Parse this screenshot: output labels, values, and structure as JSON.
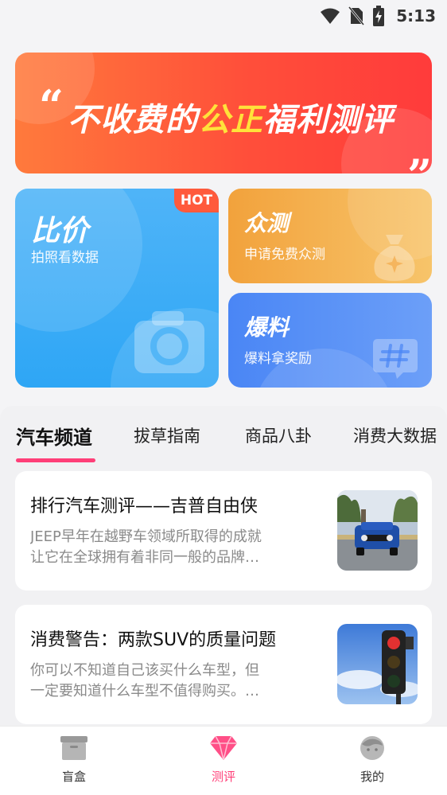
{
  "status_bar": {
    "time": "5:13"
  },
  "hero": {
    "title_prefix": "不收费的",
    "title_highlight": "公正",
    "title_suffix": "福利测评",
    "quote_open": "“",
    "quote_close": "„"
  },
  "cards": {
    "compare": {
      "title": "比价",
      "subtitle": "拍照看数据",
      "badge": "HOT",
      "icon": "camera-icon"
    },
    "crowd": {
      "title": "众测",
      "subtitle": "申请免费众测",
      "icon": "money-bag-icon"
    },
    "leak": {
      "title": "爆料",
      "subtitle": "爆料拿奖励",
      "icon": "hashtag-chat-icon"
    }
  },
  "tabs": [
    "汽车频道",
    "拔草指南",
    "商品八卦",
    "消费大数据"
  ],
  "active_tab": "汽车频道",
  "articles": [
    {
      "title": "排行汽车测评——吉普自由侠",
      "desc_line1": "JEEP早年在越野车领域所取得的成就",
      "desc_line2": "让它在全球拥有着非同一般的品牌…",
      "thumb": "blue-jeep-photo"
    },
    {
      "title": "消费警告：两款SUV的质量问题",
      "desc_line1": "你可以不知道自己该买什么车型，但",
      "desc_line2": "一定要知道什么车型不值得购买。…",
      "thumb": "traffic-light-photo"
    }
  ],
  "bottom_nav": [
    {
      "label": "盲盒",
      "icon": "box-icon"
    },
    {
      "label": "测评",
      "icon": "diamond-icon"
    },
    {
      "label": "我的",
      "icon": "user-avatar-icon"
    }
  ],
  "active_nav": "测评",
  "colors": {
    "accent_pink": "#ff3f78",
    "hero_red": "#ff4f3a",
    "highlight_yellow": "#ffe23a",
    "compare_blue": "#2ea6f5",
    "crowd_orange": "#f2a23c",
    "leak_blue": "#4a86f5"
  }
}
